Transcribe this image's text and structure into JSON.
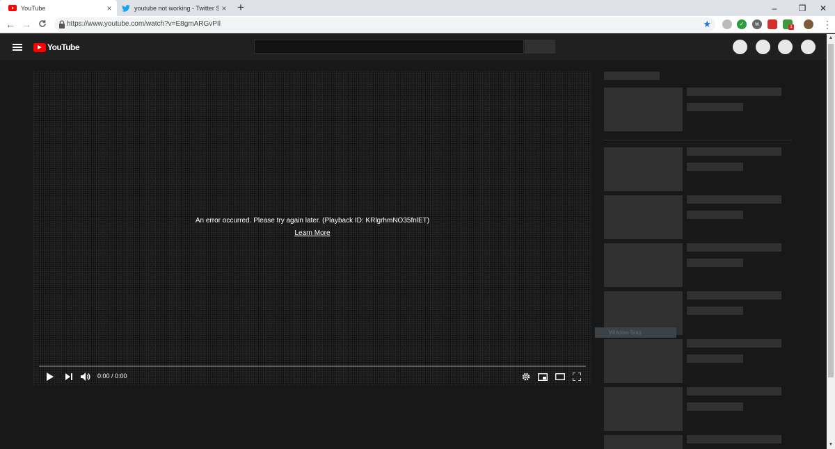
{
  "browser": {
    "tabs": [
      {
        "title": "YouTube",
        "active": true,
        "icon": "youtube-favicon"
      },
      {
        "title": "youtube not working - Twitter Se",
        "active": false,
        "icon": "twitter-favicon"
      }
    ],
    "new_tab_label": "+",
    "window_controls": {
      "minimize": "–",
      "restore": "❐",
      "close": "✕"
    },
    "nav": {
      "back": "←",
      "forward": "→",
      "reload": "C"
    },
    "url": "https://www.youtube.com/watch?v=E8gmARGvPIl",
    "bookmark_icon": "★",
    "extension_badge": "1"
  },
  "youtube": {
    "logo_text": "YouTube",
    "brand_color": "#ff0000",
    "player": {
      "error_message": "An error occurred. Please try again later. (Playback ID: KRlgrhmNO35fnlET)",
      "learn_more": "Learn More",
      "time": "0:00 / 0:00",
      "progress": 0
    }
  },
  "overlay": {
    "snip_label": "Window Snip"
  }
}
